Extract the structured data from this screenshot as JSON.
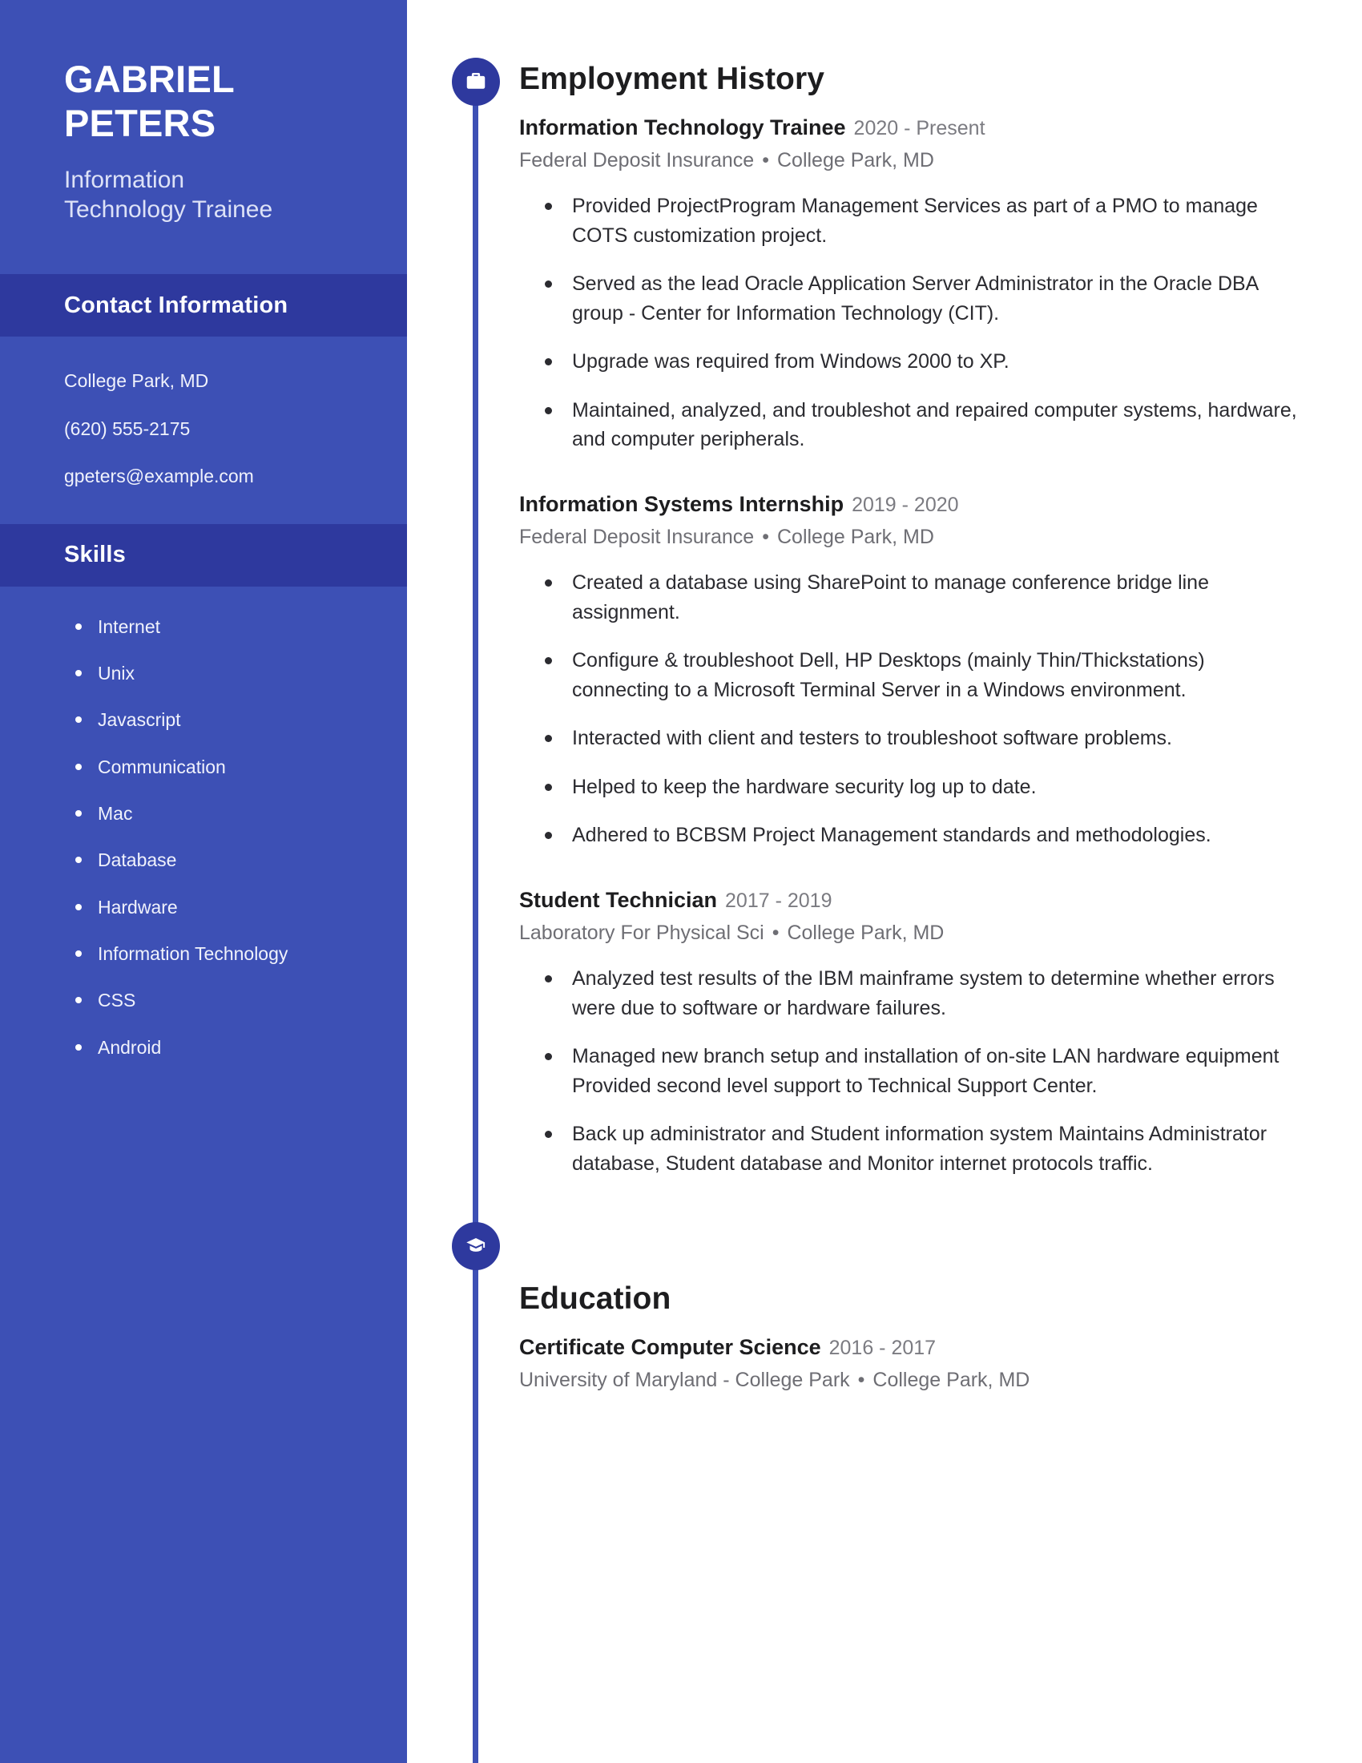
{
  "theme": {
    "sidebar_bg": "#3d50b5",
    "band_bg": "#2e399e",
    "node_bg": "#2e399e",
    "text_dark": "#1d1d1f",
    "text_muted": "#6e6e74"
  },
  "sidebar": {
    "name_first": "GABRIEL",
    "name_last": "PETERS",
    "role_line1": "Information",
    "role_line2": "Technology Trainee",
    "contact": {
      "heading": "Contact Information",
      "items": [
        "College Park, MD",
        "(620) 555-2175",
        "gpeters@example.com"
      ]
    },
    "skills": {
      "heading": "Skills",
      "items": [
        "Internet",
        "Unix",
        "Javascript",
        "Communication",
        "Mac",
        "Database",
        "Hardware",
        "Information Technology",
        "CSS",
        "Android"
      ]
    }
  },
  "main": {
    "employment": {
      "heading": "Employment History",
      "icon": "briefcase-icon",
      "entries": [
        {
          "title": "Information Technology Trainee",
          "dates": "2020 - Present",
          "company": "Federal Deposit Insurance",
          "location": "College Park, MD",
          "bullets": [
            "Provided ProjectProgram Management Services as part of a PMO to manage COTS customization project.",
            "Served as the lead Oracle Application Server Administrator in the Oracle DBA group - Center for Information Technology (CIT).",
            "Upgrade was required from Windows 2000 to XP.",
            "Maintained, analyzed, and troubleshot and repaired computer systems, hardware, and computer peripherals."
          ]
        },
        {
          "title": "Information Systems Internship",
          "dates": "2019 - 2020",
          "company": "Federal Deposit Insurance",
          "location": "College Park, MD",
          "bullets": [
            "Created a database using SharePoint to manage conference bridge line assignment.",
            "Configure & troubleshoot Dell, HP Desktops (mainly Thin/Thickstations) connecting to a Microsoft Terminal Server in a Windows environment.",
            "Interacted with client and testers to troubleshoot software problems.",
            "Helped to keep the hardware security log up to date.",
            "Adhered to BCBSM Project Management standards and methodologies."
          ]
        },
        {
          "title": "Student Technician",
          "dates": "2017 - 2019",
          "company": "Laboratory For Physical Sci",
          "location": "College Park, MD",
          "bullets": [
            "Analyzed test results of the IBM mainframe system to determine whether errors were due to software or hardware failures.",
            "Managed new branch setup and installation of on-site LAN hardware equipment Provided second level support to Technical Support Center.",
            "Back up administrator and Student information system Maintains Administrator database, Student database and Monitor internet protocols traffic."
          ]
        }
      ]
    },
    "education": {
      "heading": "Education",
      "icon": "graduation-cap-icon",
      "entries": [
        {
          "title": "Certificate Computer Science",
          "dates": "2016 - 2017",
          "school": "University of Maryland - College Park",
          "location": "College Park, MD"
        }
      ]
    },
    "separator": "•"
  }
}
